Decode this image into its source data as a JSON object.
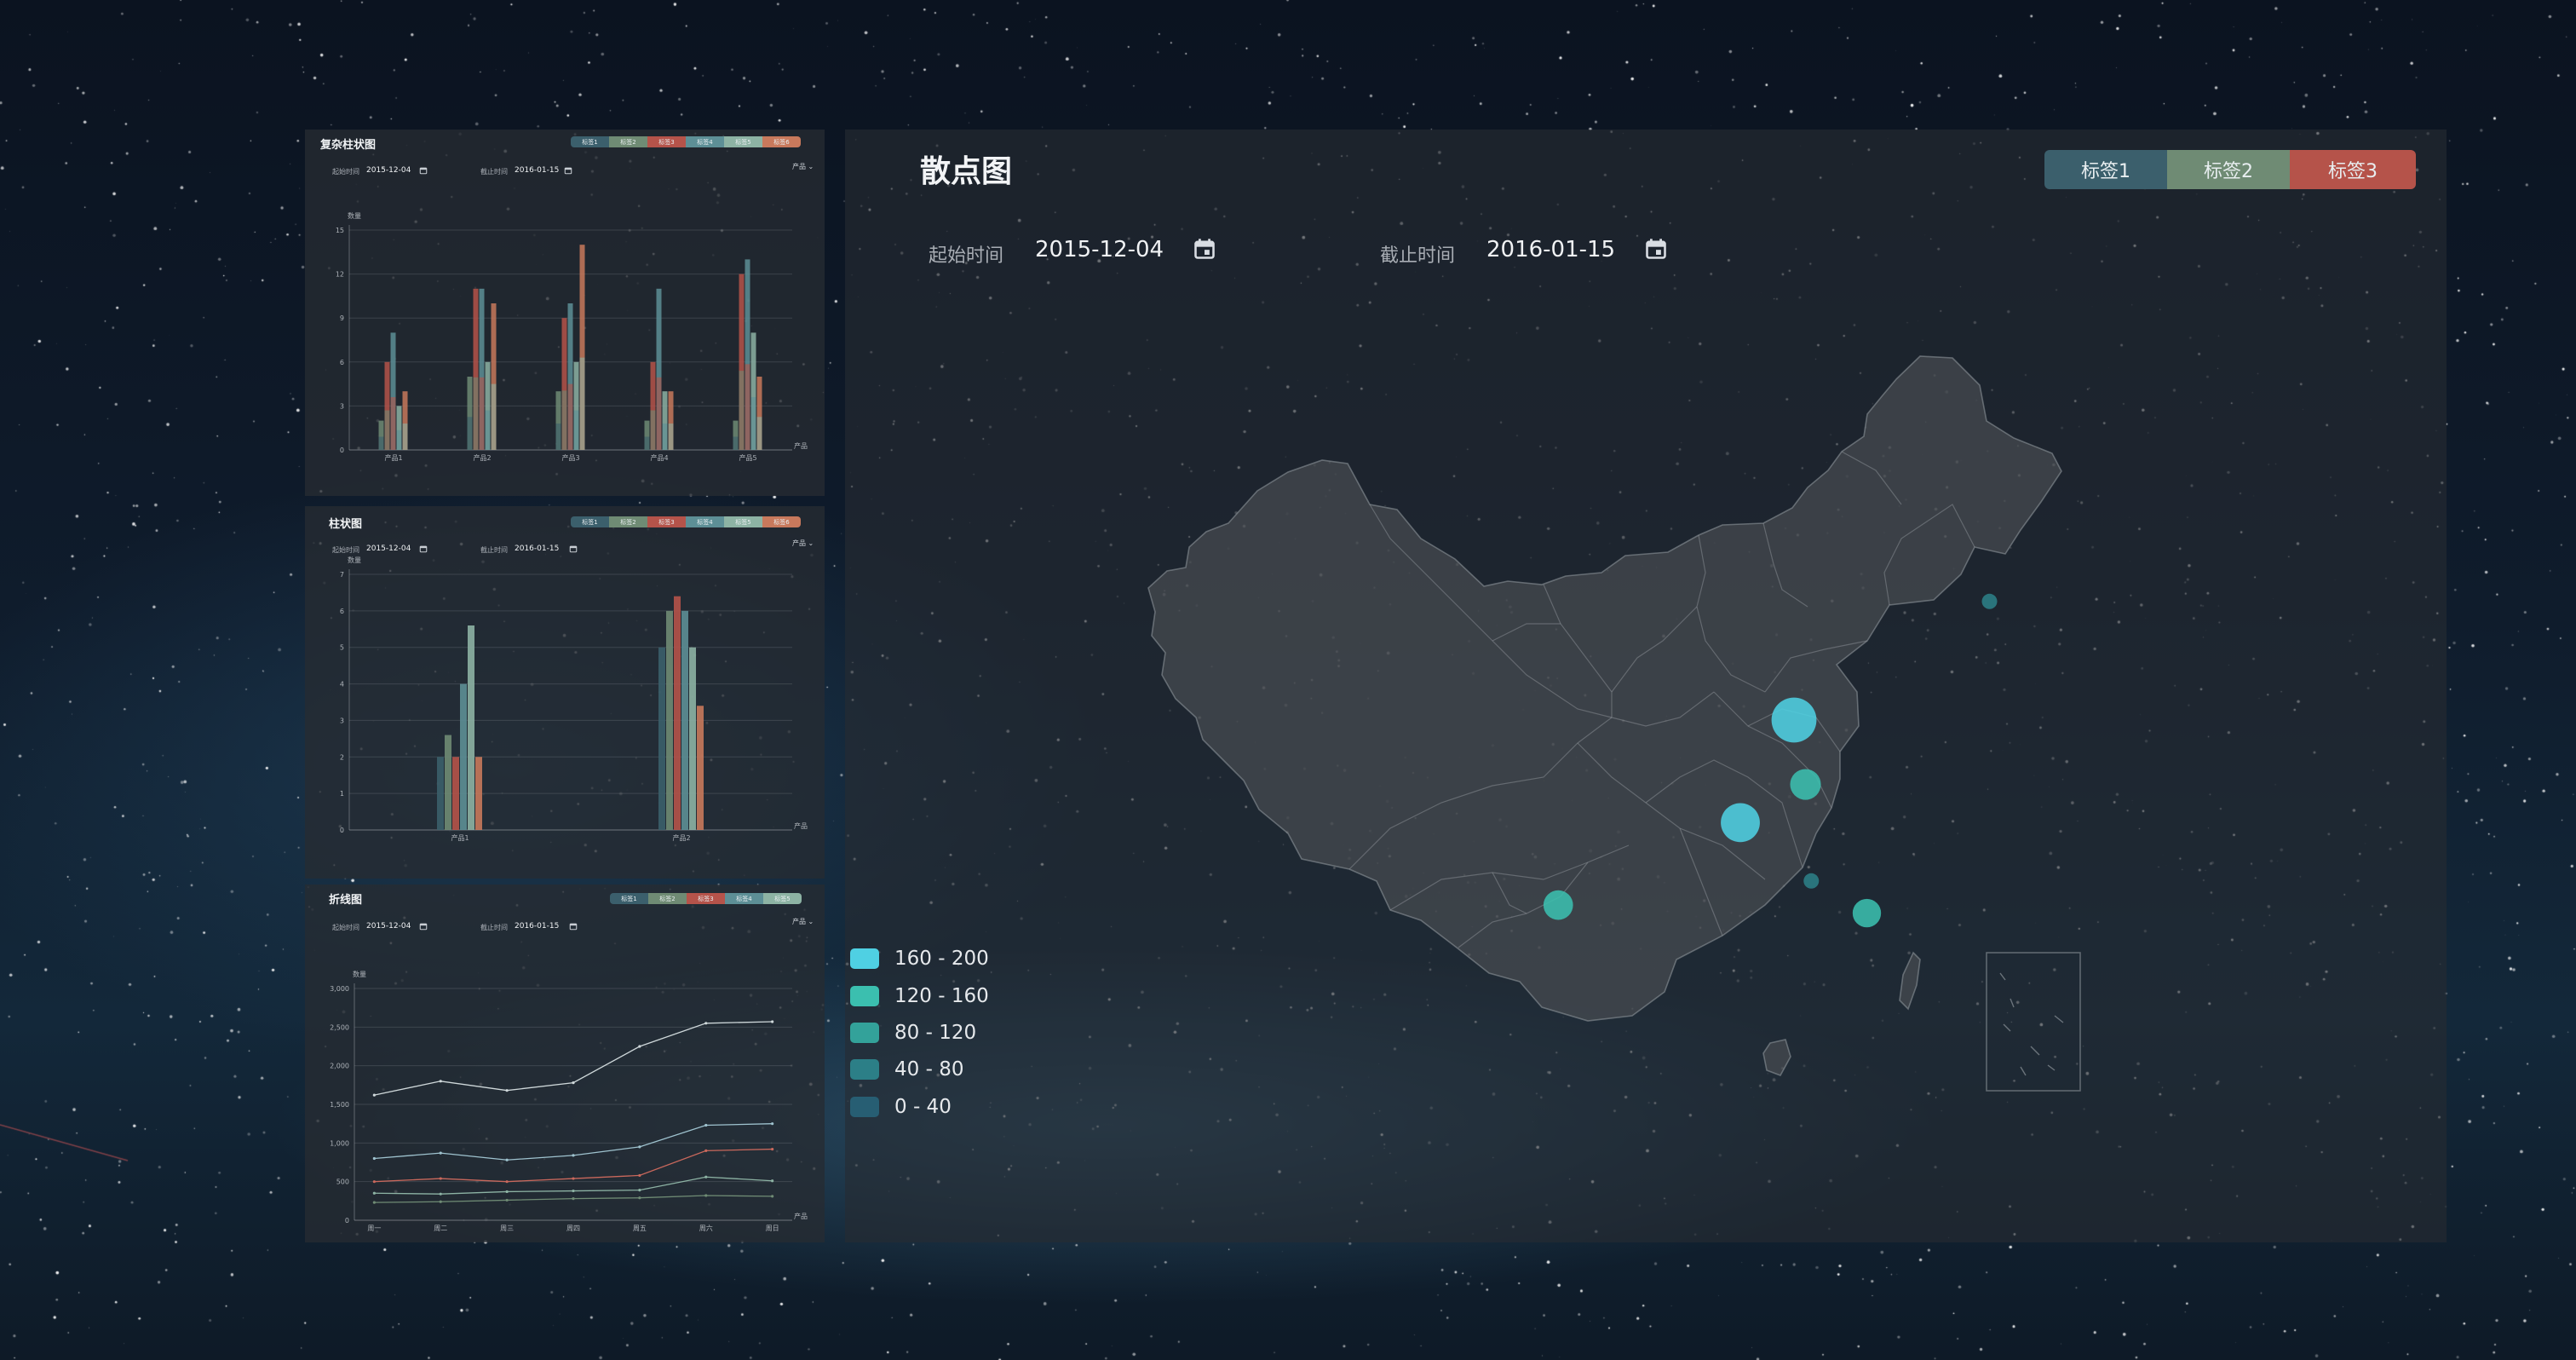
{
  "colors": {
    "tag1": "#3b5f6c",
    "tag2": "#6f8b74",
    "tag3": "#b5534a",
    "tag4": "#5d8f96",
    "tag5": "#8db3a4",
    "tag6": "#c8795c",
    "accent": "#4fd0e3",
    "panel": "#262b32"
  },
  "panel1": {
    "title": "复杂柱状图",
    "tags": [
      "标签1",
      "标签2",
      "标签3",
      "标签4",
      "标签5",
      "标签6"
    ],
    "start_label": "起始时间",
    "start_value": "2015-12-04",
    "end_label": "截止时间",
    "end_value": "2016-01-15",
    "product_select": "产品"
  },
  "panel2": {
    "title": "柱状图",
    "tags": [
      "标签1",
      "标签2",
      "标签3",
      "标签4",
      "标签5",
      "标签6"
    ],
    "start_label": "起始时间",
    "start_value": "2015-12-04",
    "end_label": "截止时间",
    "end_value": "2016-01-15",
    "product_select": "产品"
  },
  "panel3": {
    "title": "折线图",
    "tags": [
      "标签1",
      "标签2",
      "标签3",
      "标签4",
      "标签5"
    ],
    "start_label": "起始时间",
    "start_value": "2015-12-04",
    "end_label": "截止时间",
    "end_value": "2016-01-15",
    "product_select": "产品"
  },
  "main": {
    "title": "散点图",
    "tags": [
      "标签1",
      "标签2",
      "标签3"
    ],
    "start_label": "起始时间",
    "start_value": "2015-12-04",
    "end_label": "截止时间",
    "end_value": "2016-01-15",
    "icons": [
      "calendar-icon",
      "calendar-icon"
    ]
  },
  "chart_data": [
    {
      "type": "bar",
      "ylabel": "数量",
      "xlabel": "产品",
      "ylim": [
        0,
        15
      ],
      "yticks": [
        0,
        3,
        6,
        9,
        12,
        15
      ],
      "categories": [
        "产品1",
        "产品2",
        "产品3",
        "产品4",
        "产品5"
      ],
      "series": [
        {
          "name": "标签1",
          "values": [
            2,
            5,
            4,
            2,
            2
          ]
        },
        {
          "name": "标签2",
          "values": [
            6,
            11,
            9,
            6,
            12
          ]
        },
        {
          "name": "标签3",
          "values": [
            8,
            11,
            10,
            11,
            13
          ]
        },
        {
          "name": "标签4",
          "values": [
            3,
            6,
            6,
            4,
            8
          ]
        },
        {
          "name": "标签5",
          "values": [
            4,
            10,
            14,
            4,
            5
          ]
        }
      ]
    },
    {
      "type": "bar",
      "ylabel": "数量",
      "xlabel": "产品",
      "ylim": [
        0,
        7
      ],
      "yticks": [
        0,
        1,
        2,
        3,
        4,
        5,
        6,
        7
      ],
      "categories": [
        "产品1",
        "产品2"
      ],
      "series": [
        {
          "name": "标签1",
          "values": [
            2,
            5
          ]
        },
        {
          "name": "标签2",
          "values": [
            2.6,
            6
          ]
        },
        {
          "name": "标签3",
          "values": [
            2,
            6.4
          ]
        },
        {
          "name": "标签4",
          "values": [
            4,
            6
          ]
        },
        {
          "name": "标签5",
          "values": [
            5.6,
            5
          ]
        },
        {
          "name": "标签6",
          "values": [
            2,
            3.4
          ]
        }
      ]
    },
    {
      "type": "line",
      "ylabel": "数量",
      "xlabel": "产品",
      "ylim": [
        0,
        3000
      ],
      "yticks": [
        0,
        500,
        1000,
        1500,
        2000,
        2500,
        3000
      ],
      "categories": [
        "周一",
        "周二",
        "周三",
        "周四",
        "周五",
        "周六",
        "周日"
      ],
      "series": [
        {
          "name": "标签1",
          "values": [
            1620,
            1800,
            1680,
            1780,
            2250,
            2550,
            2570
          ]
        },
        {
          "name": "标签2",
          "values": [
            800,
            870,
            780,
            840,
            950,
            1230,
            1250
          ]
        },
        {
          "name": "标签3",
          "values": [
            500,
            540,
            500,
            540,
            580,
            900,
            920
          ]
        },
        {
          "name": "标签4",
          "values": [
            350,
            340,
            370,
            380,
            390,
            560,
            510
          ]
        },
        {
          "name": "标签5",
          "values": [
            230,
            240,
            260,
            280,
            290,
            320,
            310
          ]
        }
      ]
    },
    {
      "type": "scatter",
      "legend": [
        "160 - 200",
        "120 - 160",
        "80 - 120",
        "40 - 80",
        "0 - 40"
      ],
      "legend_colors": [
        "#4fd0e3",
        "#3bbfaf",
        "#33a29a",
        "#2c7f87",
        "#275e73"
      ],
      "points": [
        {
          "lon": 116.4,
          "lat": 39.9,
          "value": 190
        },
        {
          "lon": 117.0,
          "lat": 36.7,
          "value": 130
        },
        {
          "lon": 113.6,
          "lat": 34.8,
          "value": 165
        },
        {
          "lon": 104.1,
          "lat": 30.7,
          "value": 125
        },
        {
          "lon": 120.2,
          "lat": 30.3,
          "value": 120
        },
        {
          "lon": 117.3,
          "lat": 31.9,
          "value": 60
        },
        {
          "lon": 126.6,
          "lat": 45.8,
          "value": 50
        }
      ]
    }
  ]
}
